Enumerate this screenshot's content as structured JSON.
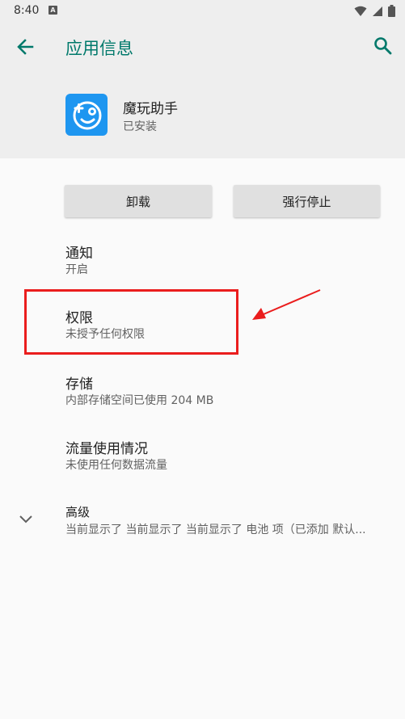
{
  "status_bar": {
    "time": "8:40",
    "notification_glyph": "A",
    "icons": [
      "wifi-icon",
      "signal-icon",
      "battery-icon"
    ]
  },
  "header": {
    "title": "应用信息",
    "back_icon": "arrow-left-icon",
    "search_icon": "search-icon"
  },
  "app": {
    "name": "魔玩助手",
    "status": "已安装",
    "icon_color": "#1e96f0"
  },
  "actions": {
    "uninstall_label": "卸载",
    "force_stop_label": "强行停止"
  },
  "settings": {
    "notifications": {
      "title": "通知",
      "summary": "开启"
    },
    "permissions": {
      "title": "权限",
      "summary": "未授予任何权限"
    },
    "storage": {
      "title": "存储",
      "summary": "内部存储空间已使用 204 MB"
    },
    "data_usage": {
      "title": "流量使用情况",
      "summary": "未使用任何数据流量"
    },
    "advanced": {
      "title": "高级",
      "summary": "当前显示了 当前显示了 当前显示了 电池 项（已添加 默认..."
    }
  },
  "colors": {
    "accent": "#00796b",
    "annotation": "#ea1d1d",
    "header_bg": "#eeeeee"
  }
}
